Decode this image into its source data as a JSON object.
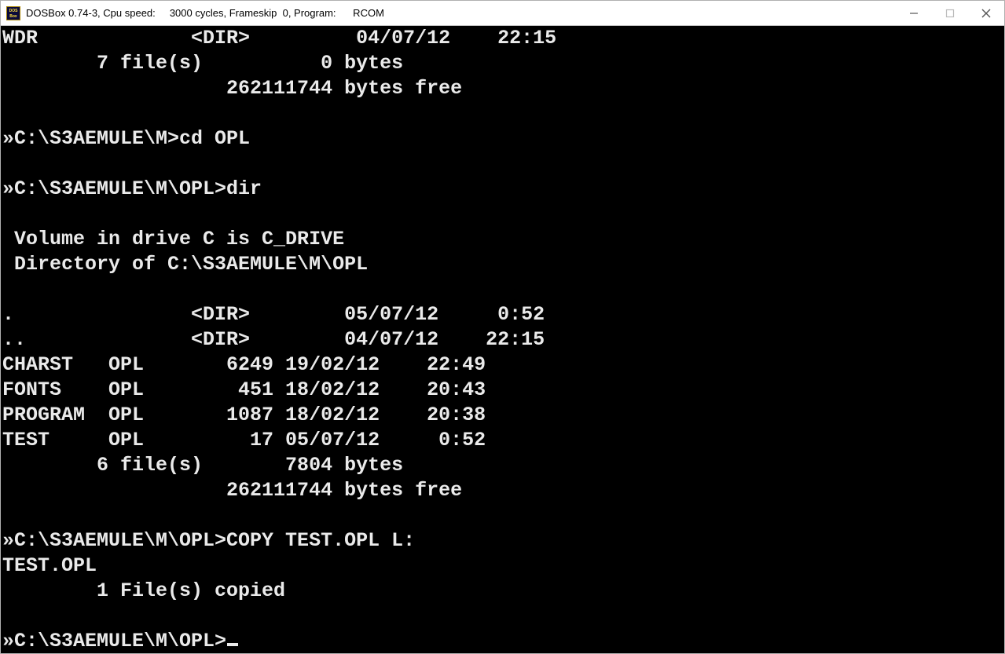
{
  "titlebar": {
    "text": "DOSBox 0.74-3, Cpu speed:     3000 cycles, Frameskip  0, Program:      RCOM"
  },
  "icon": {
    "bg": "#a88400",
    "fg": "#ffe040",
    "glyph_top": "DOS",
    "glyph_bot": "Box"
  },
  "terminal": {
    "lines": [
      "WDR             <DIR>         04/07/12    22:15",
      "        7 file(s)          0 bytes",
      "                   262111744 bytes free",
      "",
      "»C:\\S3AEMULE\\M>cd OPL",
      "",
      "»C:\\S3AEMULE\\M\\OPL>dir",
      "",
      " Volume in drive C is C_DRIVE",
      " Directory of C:\\S3AEMULE\\M\\OPL",
      "",
      ".               <DIR>        05/07/12     0:52",
      "..              <DIR>        04/07/12    22:15",
      "CHARST   OPL       6249 19/02/12    22:49",
      "FONTS    OPL        451 18/02/12    20:43",
      "PROGRAM  OPL       1087 18/02/12    20:38",
      "TEST     OPL         17 05/07/12     0:52",
      "        6 file(s)       7804 bytes",
      "                   262111744 bytes free",
      "",
      "»C:\\S3AEMULE\\M\\OPL>COPY TEST.OPL L:",
      "TEST.OPL",
      "        1 File(s) copied",
      "",
      "»C:\\S3AEMULE\\M\\OPL>"
    ]
  }
}
